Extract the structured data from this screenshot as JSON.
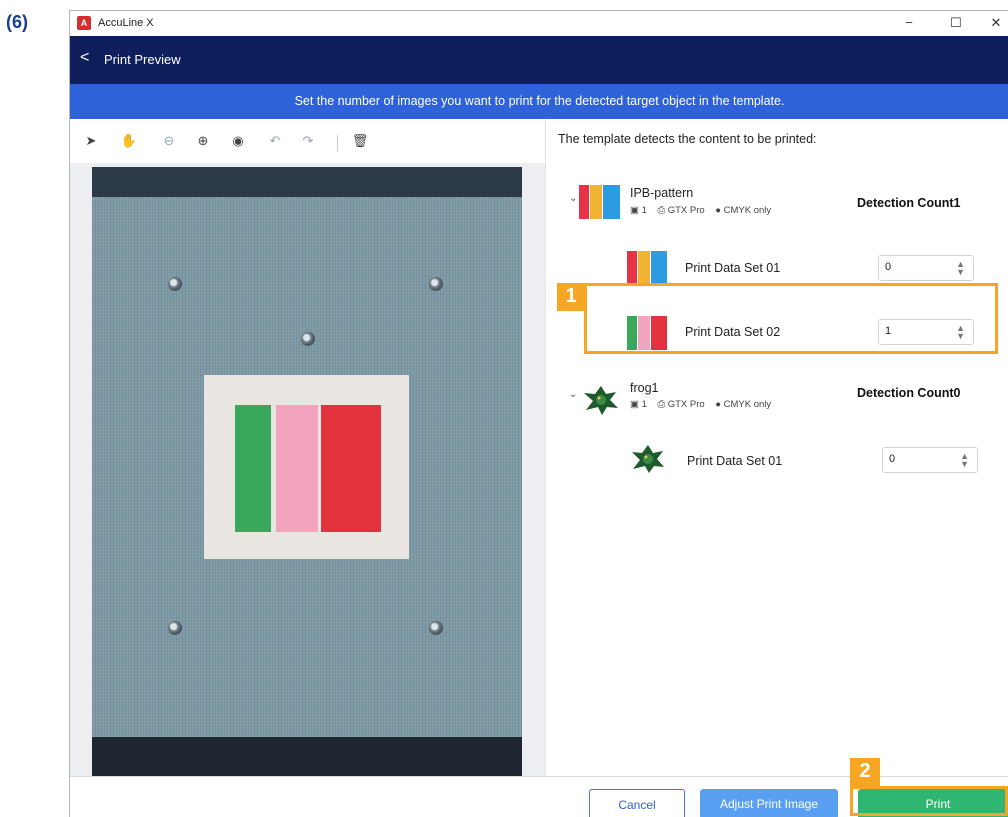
{
  "step_label": "(6)",
  "window": {
    "app_title": "AccuLine X",
    "minimize_glyph": "−",
    "maximize_glyph": "☐",
    "close_glyph": "✕"
  },
  "header": {
    "back_glyph": "<",
    "title": "Print Preview"
  },
  "banner": {
    "text": "Set the number of images you want to print for the detected target object in the template."
  },
  "toolbar": {
    "tools": [
      {
        "name": "select-icon",
        "glyph": "➤"
      },
      {
        "name": "hand-icon",
        "glyph": "✋"
      },
      {
        "name": "zoom-out-icon",
        "glyph": "⊖"
      },
      {
        "name": "zoom-in-icon",
        "glyph": "⊕"
      },
      {
        "name": "eye-icon",
        "glyph": "◉"
      },
      {
        "name": "undo-icon",
        "glyph": "↶"
      },
      {
        "name": "redo-icon",
        "glyph": "↷"
      },
      {
        "name": "delete-icon",
        "glyph": "🗑"
      }
    ]
  },
  "panel": {
    "detect_title": "The template detects the content to be printed:",
    "groups": [
      {
        "name": "IPB-pattern",
        "image_count": "1",
        "printer": "GTX Pro",
        "color_mode": "CMYK only",
        "detection_label": "Detection Count1",
        "sets": [
          {
            "label": "Print Data Set 01",
            "value": "0"
          },
          {
            "label": "Print Data Set 02",
            "value": "1"
          }
        ]
      },
      {
        "name": "frog1",
        "image_count": "1",
        "printer": "GTX Pro",
        "color_mode": "CMYK only",
        "detection_label": "Detection Count0",
        "sets": [
          {
            "label": "Print Data Set 01",
            "value": "0"
          }
        ]
      }
    ]
  },
  "footer": {
    "cancel_label": "Cancel",
    "adjust_label": "Adjust Print Image",
    "print_label": "Print"
  },
  "callouts": {
    "one": "1",
    "two": "2",
    "color": "#f6a623"
  },
  "colors": {
    "header_bg": "#0f1f5c",
    "banner_bg": "#2f62d8",
    "print_button": "#2fb673",
    "adjust_button": "#5aa0f2"
  }
}
